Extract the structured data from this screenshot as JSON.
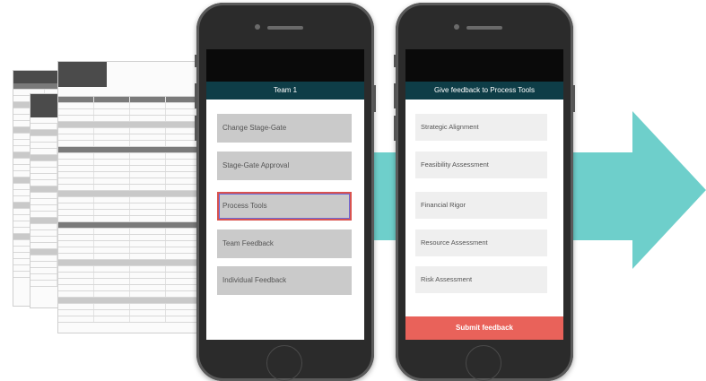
{
  "colors": {
    "arrow": "#6ecfcb",
    "nav_bar": "#0e3d47",
    "submit": "#e9625a",
    "selected_border": "#d9534f"
  },
  "phone1": {
    "title": "Team 1",
    "items": [
      {
        "label": "Change Stage-Gate"
      },
      {
        "label": "Stage-Gate Approval"
      },
      {
        "label": "Process Tools",
        "selected": true
      },
      {
        "label": "Team Feedback"
      },
      {
        "label": "Individual Feedback"
      }
    ]
  },
  "phone2": {
    "title": "Give feedback to Process Tools",
    "items": [
      {
        "label": "Strategic Alignment"
      },
      {
        "label": "Feasibility Assessment"
      },
      {
        "label": "Financial Rigor"
      },
      {
        "label": "Resource Assessment"
      },
      {
        "label": "Risk Assessment"
      }
    ],
    "submit_label": "Submit feedback"
  },
  "sheets": {
    "icons": [
      "arrow-icon",
      "spreadsheet-icon",
      "phone-icon"
    ]
  }
}
